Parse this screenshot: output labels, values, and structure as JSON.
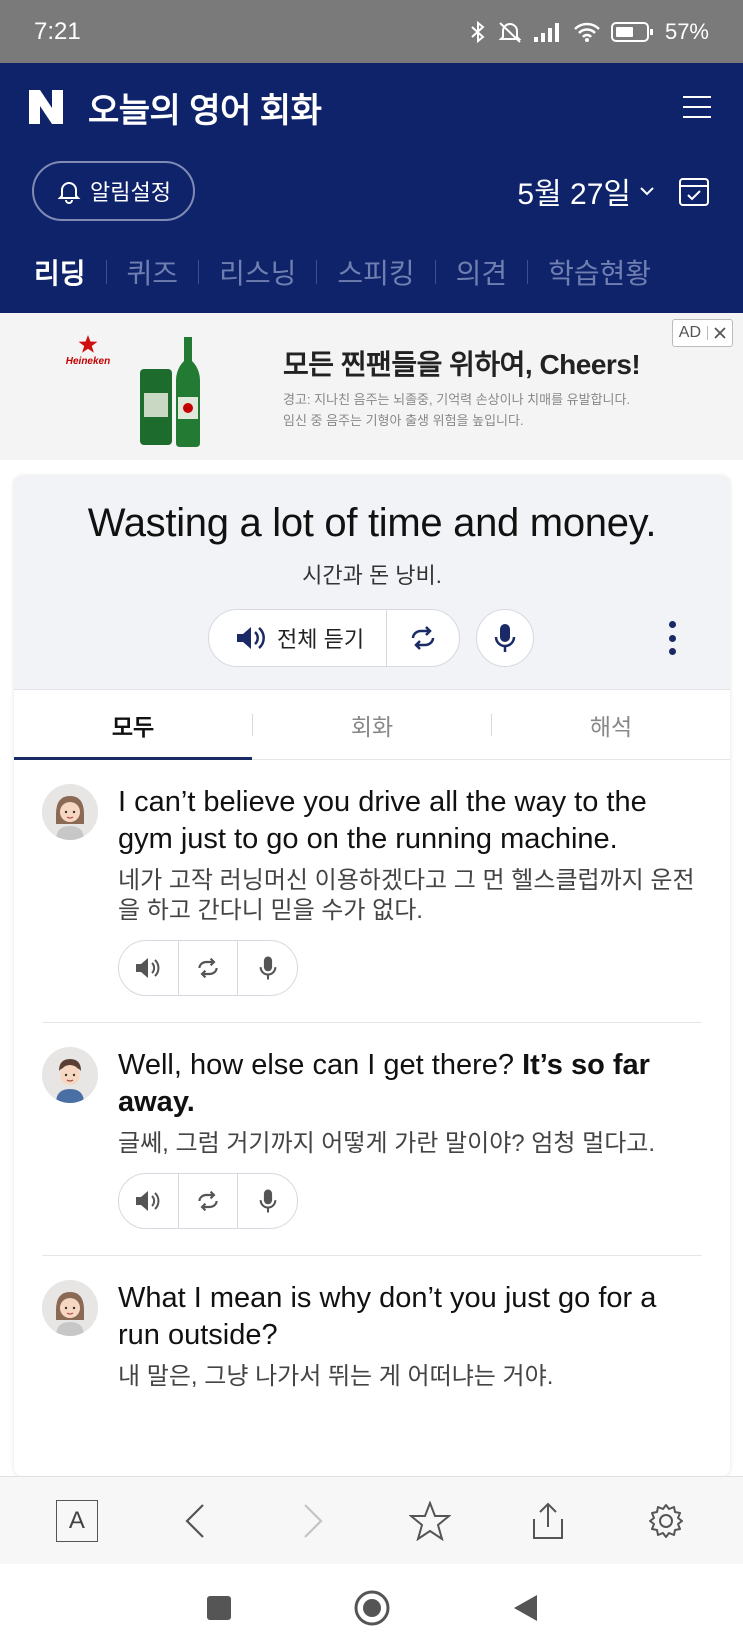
{
  "status": {
    "time": "7:21",
    "battery": "57%"
  },
  "header": {
    "title": "오늘의 영어 회화"
  },
  "sub_header": {
    "alarm_label": "알림설정",
    "date": "5월 27일"
  },
  "tabs": [
    "리딩",
    "퀴즈",
    "리스닝",
    "스피킹",
    "의견",
    "학습현황"
  ],
  "ad": {
    "badge": "AD",
    "brand": "Heineken",
    "headline": "모든 찐팬들을 위하여, Cheers!",
    "warning_1": "경고: 지나친 음주는 뇌졸중, 기억력 손상이나 치매를 유발합니다.",
    "warning_2": "임신 중 음주는 기형아 출생 위험을 높입니다."
  },
  "lesson": {
    "sentence": "Wasting a lot of time and money.",
    "translation": "시간과 돈 낭비.",
    "play_all_label": "전체 듣기"
  },
  "segments": [
    "모두",
    "회화",
    "해석"
  ],
  "dialog": [
    {
      "en": "I can’t believe you drive all the way to the gym just to go on the running machine.",
      "ko": "네가 고작 러닝머신 이용하겠다고 그 먼 헬스클럽까지 운전을 하고 간다니 믿을 수가 없다."
    },
    {
      "en_plain": "Well, how else can I get there? ",
      "en_bold": "It’s so far away.",
      "ko": "글쎄, 그럼 거기까지 어떻게 가란 말이야? 엄청 멀다고."
    },
    {
      "en": "What I mean is why don’t you just go for a run outside?",
      "ko": "내 말은, 그냥 나가서 뛰는 게 어떠냐는 거야."
    }
  ],
  "browser": {
    "font_label": "A"
  },
  "colors": {
    "navy": "#0f236b",
    "accent": "#1a2a66"
  }
}
